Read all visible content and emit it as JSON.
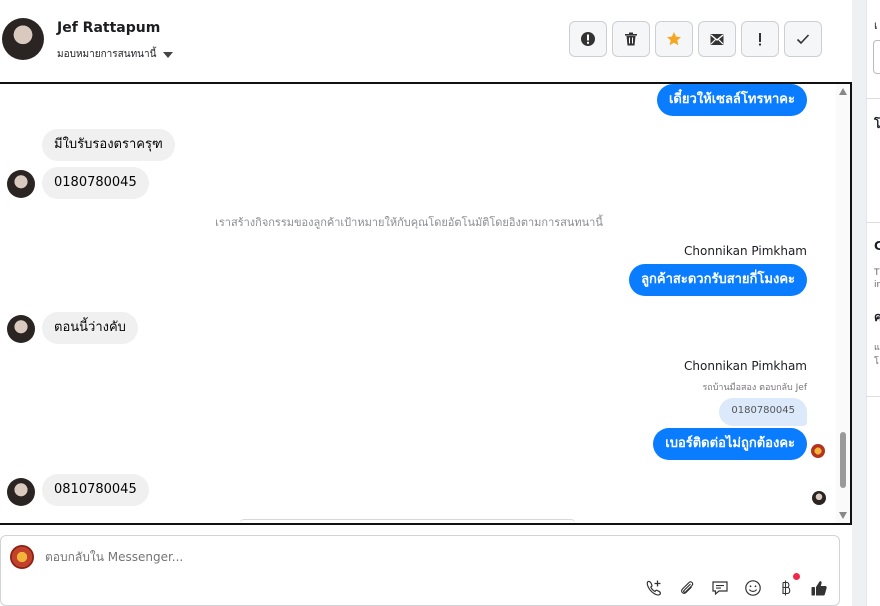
{
  "header": {
    "contact_name": "Jef Rattapum",
    "assign_label": "มอบหมายการสนทนานี้",
    "toolbar": [
      {
        "icon": "alert-circle-icon",
        "label": "!"
      },
      {
        "icon": "trash-icon",
        "label": ""
      },
      {
        "icon": "star-icon",
        "label": ""
      },
      {
        "icon": "mark-unread-icon",
        "label": ""
      },
      {
        "icon": "exclamation-icon",
        "label": "!"
      },
      {
        "icon": "check-icon",
        "label": ""
      }
    ]
  },
  "messages": {
    "m1": "เดี๋ยวให้เซลล์โทรหาคะ",
    "m2": "มีใบรับรองตราครุฑ",
    "m3": "0180780045",
    "system_note": "เราสร้างกิจกรรมของลูกค้าเป้าหมายให้กับคุณโดยอัตโนมัติโดยอิงตามการสนทนานี้",
    "sender1": "Chonnikan Pimkham",
    "m4": "ลูกค้าสะดวกรับสายกี่โมงคะ",
    "m5": "ตอนนี้ว่างคับ",
    "sender2": "Chonnikan Pimkham",
    "reply_note": "รถบ้านมือสอง ตอบกลับ Jef",
    "reply_quote": "0180780045",
    "m6": "เบอร์ติดต่อไม่ถูกต้องคะ",
    "m7": "0810780045"
  },
  "composer": {
    "placeholder": "ตอบกลับใน Messenger...",
    "icons": [
      "call-add-icon",
      "attachment-icon",
      "saved-reply-icon",
      "emoji-icon",
      "baht-payment-icon",
      "like-icon"
    ]
  },
  "right_panel": {
    "t1": "เ",
    "t2": "โ",
    "t3": "C",
    "t4": "T",
    "t5": "ir",
    "t6": "ค",
    "t7": "แ",
    "t8": "โ"
  },
  "colors": {
    "outgoing_bubble": "#0a7cff",
    "incoming_bubble": "#f0f0f0",
    "star": "#f5a623"
  }
}
